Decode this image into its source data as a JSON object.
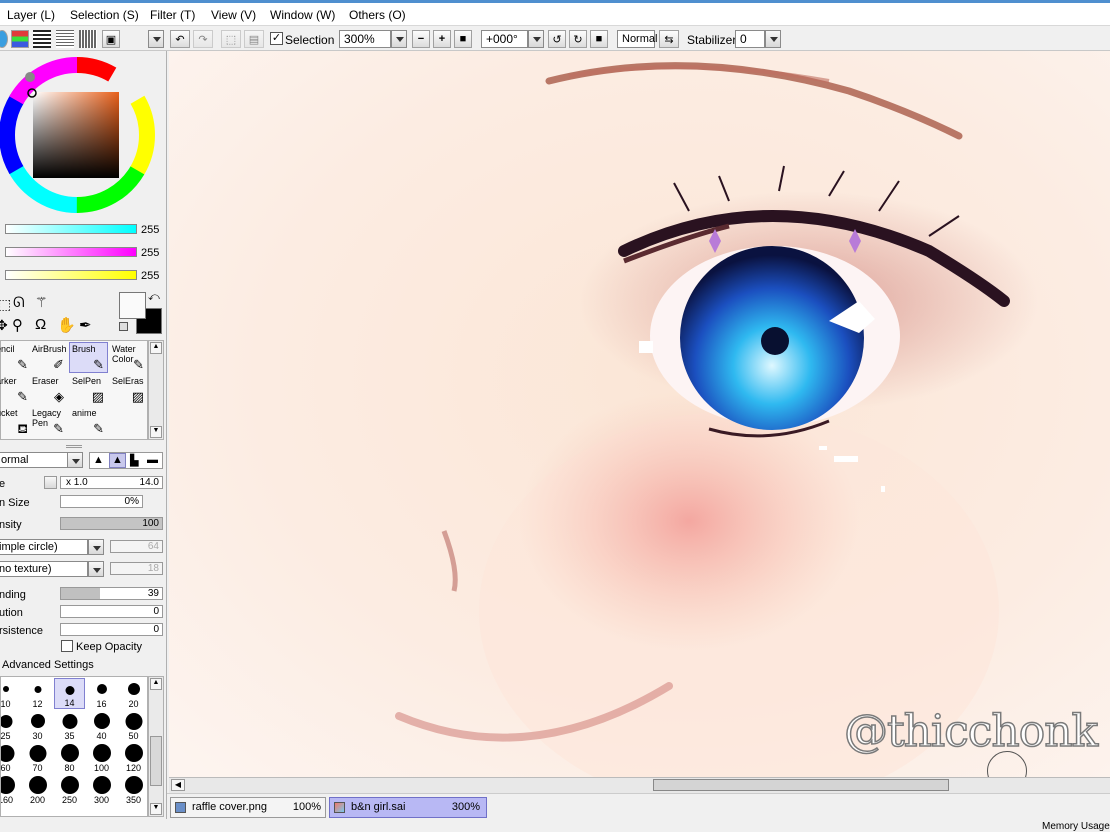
{
  "menu": {
    "layer": "Layer (L)",
    "selection": "Selection (S)",
    "filter": "Filter (T)",
    "view": "View (V)",
    "window": "Window (W)",
    "others": "Others (O)"
  },
  "toolbar": {
    "selection_label": "Selection",
    "zoom": "300%",
    "rotation": "+000°",
    "blend_mode": "Normal",
    "stabilizer_label": "Stabilizer",
    "stabilizer_value": "0"
  },
  "color_sliders": [
    {
      "value": "255",
      "color": "cyan"
    },
    {
      "value": "255",
      "color": "magenta"
    },
    {
      "value": "255",
      "color": "yellow"
    }
  ],
  "tools": [
    {
      "label": "encil"
    },
    {
      "label": "AirBrush"
    },
    {
      "label": "Brush"
    },
    {
      "label": "Water Color"
    },
    {
      "label": "arker"
    },
    {
      "label": "Eraser"
    },
    {
      "label": "SelPen"
    },
    {
      "label": "SelEras"
    },
    {
      "label": "ucket"
    },
    {
      "label": "Legacy Pen"
    },
    {
      "label": "anime"
    }
  ],
  "brush_settings": {
    "blend": "ormal",
    "size_label": "e",
    "size_mult": "x 1.0",
    "size_value": "14.0",
    "min_size_label": "n Size",
    "min_size_value": "0%",
    "density_label": "nsity",
    "density_value": "100",
    "shape": "imple circle)",
    "shape_value": "64",
    "texture": "no texture)",
    "texture_value": "18",
    "blending_label": "nding",
    "blending_value": "39",
    "dilution_label": "ution",
    "dilution_value": "0",
    "persistence_label": "rsistence",
    "persistence_value": "0",
    "keep_opacity": "Keep Opacity",
    "advanced": "Advanced Settings"
  },
  "brush_sizes": [
    "10",
    "12",
    "14",
    "16",
    "20",
    "25",
    "30",
    "35",
    "40",
    "50",
    "60",
    "70",
    "80",
    "100",
    "120",
    "160",
    "200",
    "250",
    "300",
    "350"
  ],
  "documents": [
    {
      "name": "raffle cover.png",
      "zoom": "100%"
    },
    {
      "name": "b&n girl.sai",
      "zoom": "300%"
    }
  ],
  "watermark": "@thicchonk",
  "status": {
    "memory": "Memory Usage"
  }
}
